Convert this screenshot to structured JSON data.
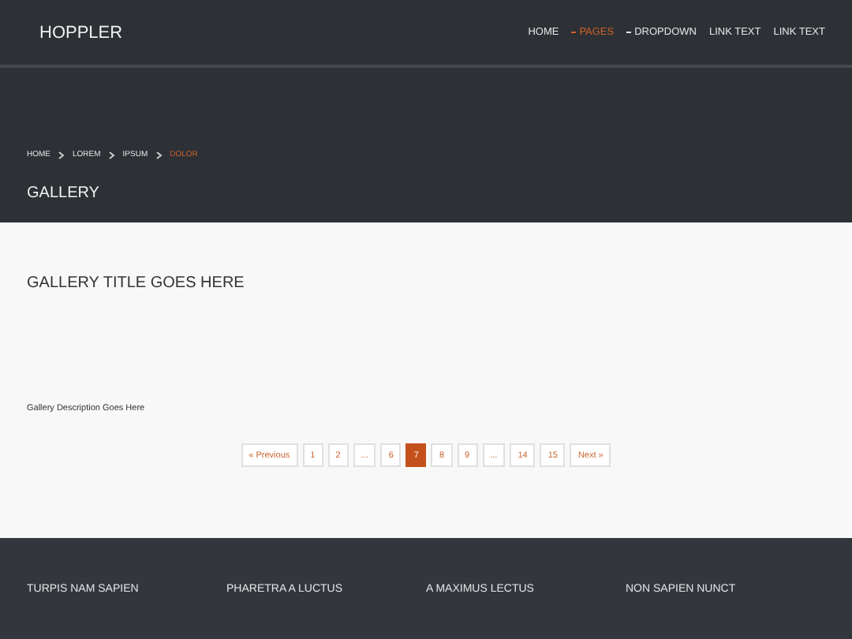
{
  "brand": "HOPPLER",
  "nav": [
    {
      "label": "HOME",
      "kind": "link",
      "selected": false
    },
    {
      "label": "PAGES",
      "kind": "dropdown",
      "selected": true
    },
    {
      "label": "DROPDOWN",
      "kind": "dropdown",
      "selected": false
    },
    {
      "label": "LINK TEXT",
      "kind": "link",
      "selected": false
    },
    {
      "label": "LINK TEXT",
      "kind": "link",
      "selected": false
    }
  ],
  "breadcrumb": [
    {
      "label": "HOME",
      "selected": false
    },
    {
      "label": "LOREM",
      "selected": false
    },
    {
      "label": "IPSUM",
      "selected": false
    },
    {
      "label": "DOLOR",
      "selected": true
    }
  ],
  "page_title": "GALLERY",
  "gallery_title": "GALLERY TITLE GOES HERE",
  "gallery_description": "Gallery Description Goes Here",
  "pagination": [
    {
      "label": "« Previous",
      "selected": false
    },
    {
      "label": "1",
      "selected": false
    },
    {
      "label": "2",
      "selected": false
    },
    {
      "label": "...",
      "selected": false
    },
    {
      "label": "6",
      "selected": false
    },
    {
      "label": "7",
      "selected": true
    },
    {
      "label": "8",
      "selected": false
    },
    {
      "label": "9",
      "selected": false
    },
    {
      "label": "...",
      "selected": false
    },
    {
      "label": "14",
      "selected": false
    },
    {
      "label": "15",
      "selected": false
    },
    {
      "label": "Next »",
      "selected": false
    }
  ],
  "footer_headings": [
    "TURPIS NAM SAPIEN",
    "PHARETRA A LUCTUS",
    "A MAXIMUS LECTUS",
    "NON SAPIEN NUNCT"
  ]
}
